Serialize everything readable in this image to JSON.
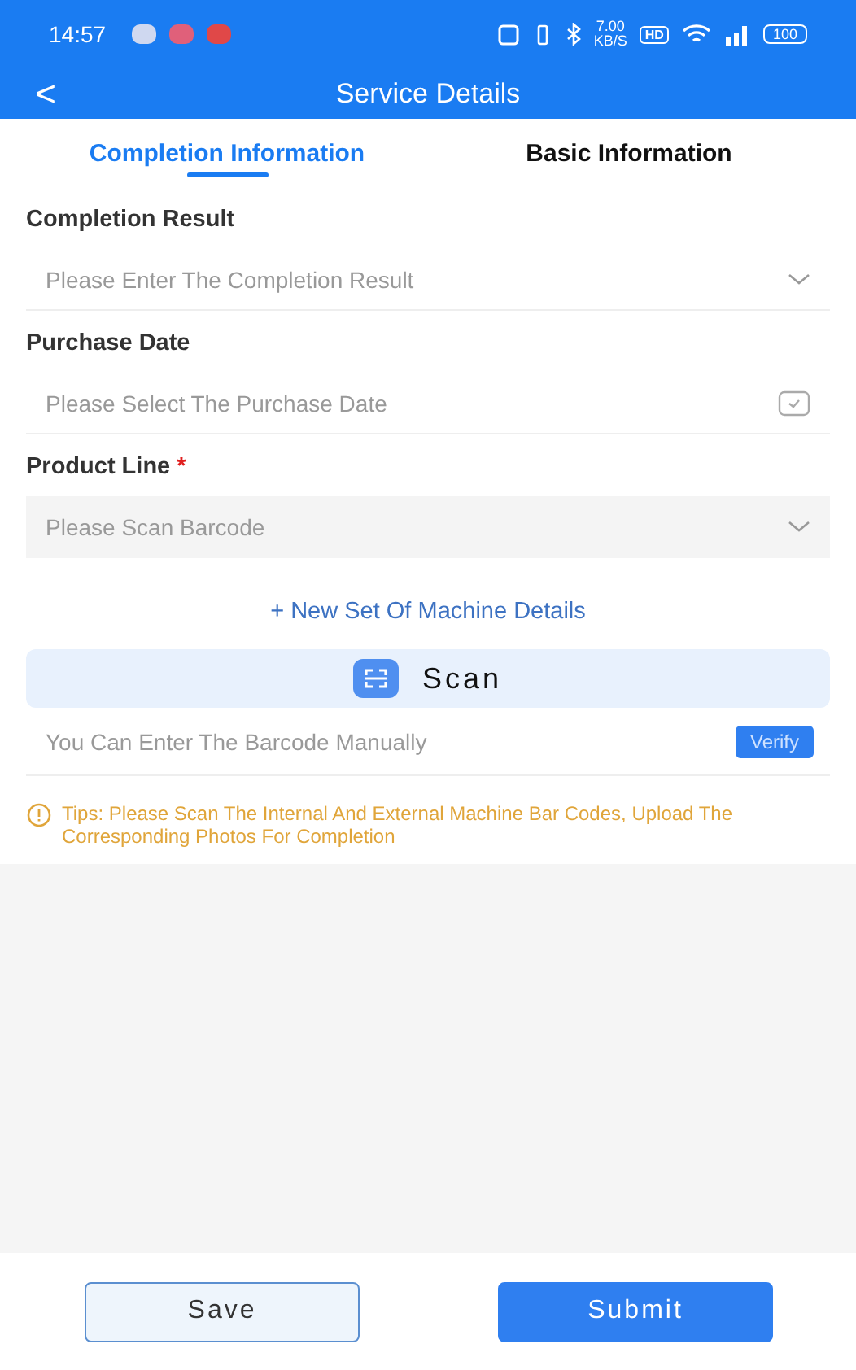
{
  "status_bar": {
    "time": "14:57",
    "speed": "7.00",
    "speed_unit": "KB/S",
    "hd": "HD",
    "battery": "100"
  },
  "header": {
    "back": "<",
    "title": "Service Details"
  },
  "tabs": [
    {
      "label": "Completion Information",
      "selected": true
    },
    {
      "label": "Basic Information",
      "selected": false
    }
  ],
  "fields": [
    {
      "label": "Completion Result",
      "kind": "select",
      "placeholder": "Please Enter The Completion Result"
    },
    {
      "label": "Purchase Date",
      "kind": "date",
      "placeholder": "Please Select The Purchase Date"
    },
    {
      "label": "Product Line",
      "required_mark": "*",
      "kind": "scan",
      "placeholder": "Please Scan Barcode"
    }
  ],
  "add_link": {
    "icon": "+",
    "label": "New Set Of Machine Details"
  },
  "scan_button": "Scan",
  "manual_entry": {
    "placeholder": "You Can Enter The Barcode Manually",
    "button": "Verify"
  },
  "tips": "Tips: Please Scan The Internal And External Machine Bar Codes, Upload The Corresponding Photos For Completion",
  "footer": {
    "save": "Save",
    "submit": "Submit"
  }
}
